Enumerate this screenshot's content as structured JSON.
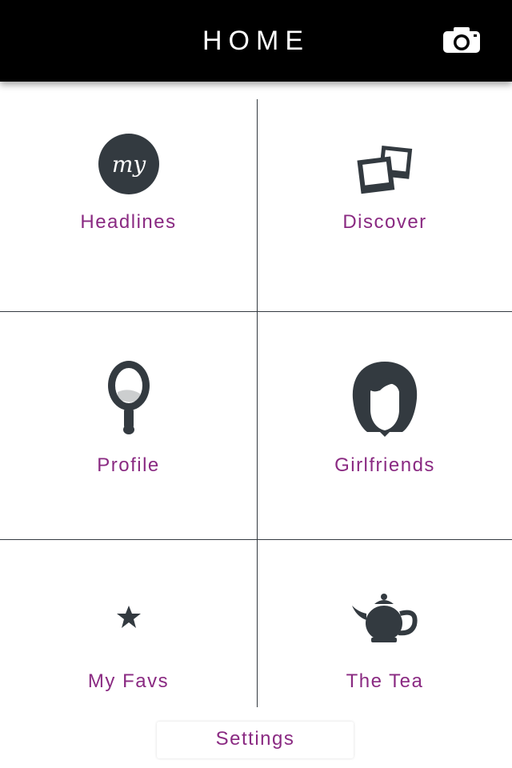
{
  "header": {
    "title": "HOME",
    "camera_icon": "camera-icon"
  },
  "tiles": [
    {
      "label": "Headlines",
      "icon": "my-badge-icon",
      "badge_text": "my"
    },
    {
      "label": "Discover",
      "icon": "photos-icon"
    },
    {
      "label": "Profile",
      "icon": "hand-mirror-icon"
    },
    {
      "label": "Girlfriends",
      "icon": "girl-silhouette-icon"
    },
    {
      "label": "My Favs",
      "icon": "star-icon"
    },
    {
      "label": "The Tea",
      "icon": "teapot-icon"
    }
  ],
  "footer": {
    "settings_label": "Settings"
  },
  "colors": {
    "header_bg": "#000000",
    "accent": "#8a2a82",
    "icon": "#333a40"
  }
}
